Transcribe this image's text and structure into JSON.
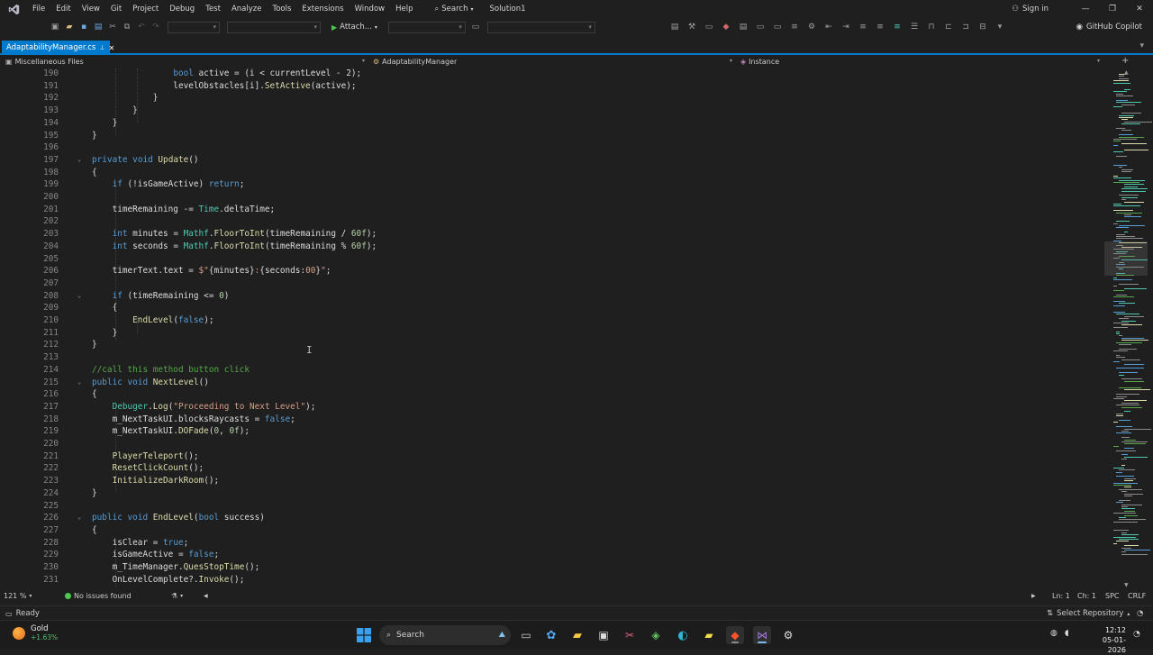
{
  "menubar": {
    "items": [
      "File",
      "Edit",
      "View",
      "Git",
      "Project",
      "Debug",
      "Test",
      "Analyze",
      "Tools",
      "Extensions",
      "Window",
      "Help"
    ],
    "search_label": "Search",
    "solution_name": "Solution1",
    "sign_in": "Sign in"
  },
  "toolbar": {
    "attach_label": "Attach...",
    "copilot_label": "GitHub Copilot"
  },
  "tab": {
    "filename": "AdaptabilityManager.cs",
    "pin_glyph": "⊥",
    "close_glyph": "✕"
  },
  "navbar": {
    "project": "Miscellaneous Files",
    "type": "AdaptabilityManager",
    "member": "Instance"
  },
  "editor": {
    "zoom": "121 %",
    "issues": "No issues found",
    "line": "Ln: 1",
    "col": "Ch: 1",
    "whitespace": "SPC",
    "eol": "CRLF"
  },
  "code_lines": [
    {
      "n": "190",
      "fold": "",
      "segs": [
        [
          "pl",
          "                "
        ],
        [
          "kw",
          "bool"
        ],
        [
          "pl",
          " active = (i < currentLevel - 2);"
        ]
      ]
    },
    {
      "n": "191",
      "fold": "",
      "segs": [
        [
          "pl",
          "                levelObstacles[i]."
        ],
        [
          "fn",
          "SetActive"
        ],
        [
          "pl",
          "(active);"
        ]
      ]
    },
    {
      "n": "192",
      "fold": "",
      "segs": [
        [
          "pl",
          "            }"
        ]
      ]
    },
    {
      "n": "193",
      "fold": "",
      "segs": [
        [
          "pl",
          "        }"
        ]
      ]
    },
    {
      "n": "194",
      "fold": "",
      "segs": [
        [
          "pl",
          "    }"
        ]
      ]
    },
    {
      "n": "195",
      "fold": "",
      "segs": [
        [
          "pl",
          "}"
        ]
      ]
    },
    {
      "n": "196",
      "fold": "",
      "segs": [
        [
          "pl",
          ""
        ]
      ]
    },
    {
      "n": "197",
      "fold": "v",
      "segs": [
        [
          "kw",
          "private"
        ],
        [
          "pl",
          " "
        ],
        [
          "kw",
          "void"
        ],
        [
          "pl",
          " "
        ],
        [
          "fn",
          "Update"
        ],
        [
          "pl",
          "()"
        ]
      ]
    },
    {
      "n": "198",
      "fold": "",
      "segs": [
        [
          "pl",
          "{"
        ]
      ]
    },
    {
      "n": "199",
      "fold": "",
      "segs": [
        [
          "pl",
          "    "
        ],
        [
          "kw",
          "if"
        ],
        [
          "pl",
          " (!isGameActive) "
        ],
        [
          "kw",
          "return"
        ],
        [
          "pl",
          ";"
        ]
      ]
    },
    {
      "n": "200",
      "fold": "",
      "segs": [
        [
          "pl",
          ""
        ]
      ]
    },
    {
      "n": "201",
      "fold": "",
      "segs": [
        [
          "pl",
          "    timeRemaining -= "
        ],
        [
          "ty",
          "Time"
        ],
        [
          "pl",
          ".deltaTime;"
        ]
      ]
    },
    {
      "n": "202",
      "fold": "",
      "segs": [
        [
          "pl",
          ""
        ]
      ]
    },
    {
      "n": "203",
      "fold": "",
      "segs": [
        [
          "pl",
          "    "
        ],
        [
          "kw",
          "int"
        ],
        [
          "pl",
          " minutes = "
        ],
        [
          "ty",
          "Mathf"
        ],
        [
          "pl",
          "."
        ],
        [
          "fn",
          "FloorToInt"
        ],
        [
          "pl",
          "(timeRemaining / "
        ],
        [
          "num",
          "60f"
        ],
        [
          "pl",
          ");"
        ]
      ]
    },
    {
      "n": "204",
      "fold": "",
      "segs": [
        [
          "pl",
          "    "
        ],
        [
          "kw",
          "int"
        ],
        [
          "pl",
          " seconds = "
        ],
        [
          "ty",
          "Mathf"
        ],
        [
          "pl",
          "."
        ],
        [
          "fn",
          "FloorToInt"
        ],
        [
          "pl",
          "(timeRemaining % "
        ],
        [
          "num",
          "60f"
        ],
        [
          "pl",
          ");"
        ]
      ]
    },
    {
      "n": "205",
      "fold": "",
      "segs": [
        [
          "pl",
          ""
        ]
      ]
    },
    {
      "n": "206",
      "fold": "",
      "segs": [
        [
          "pl",
          "    timerText.text = "
        ],
        [
          "str",
          "$\""
        ],
        [
          "pl",
          "{minutes}"
        ],
        [
          "str",
          ":"
        ],
        [
          "pl",
          "{seconds:"
        ],
        [
          "str",
          "00"
        ],
        [
          "pl",
          "}"
        ],
        [
          "str",
          "\""
        ],
        [
          "pl",
          ";"
        ]
      ]
    },
    {
      "n": "207",
      "fold": "",
      "segs": [
        [
          "pl",
          ""
        ]
      ]
    },
    {
      "n": "208",
      "fold": "v",
      "segs": [
        [
          "pl",
          "    "
        ],
        [
          "kw",
          "if"
        ],
        [
          "pl",
          " (timeRemaining <= "
        ],
        [
          "num",
          "0"
        ],
        [
          "pl",
          ")"
        ]
      ]
    },
    {
      "n": "209",
      "fold": "",
      "segs": [
        [
          "pl",
          "    {"
        ]
      ]
    },
    {
      "n": "210",
      "fold": "",
      "segs": [
        [
          "pl",
          "        "
        ],
        [
          "fn",
          "EndLevel"
        ],
        [
          "pl",
          "("
        ],
        [
          "kw",
          "false"
        ],
        [
          "pl",
          ");"
        ]
      ]
    },
    {
      "n": "211",
      "fold": "",
      "segs": [
        [
          "pl",
          "    }"
        ]
      ]
    },
    {
      "n": "212",
      "fold": "",
      "segs": [
        [
          "pl",
          "}"
        ]
      ]
    },
    {
      "n": "213",
      "fold": "",
      "segs": [
        [
          "pl",
          ""
        ]
      ]
    },
    {
      "n": "214",
      "fold": "",
      "segs": [
        [
          "cm",
          "//call this method button click"
        ]
      ]
    },
    {
      "n": "215",
      "fold": "v",
      "segs": [
        [
          "kw",
          "public"
        ],
        [
          "pl",
          " "
        ],
        [
          "kw",
          "void"
        ],
        [
          "pl",
          " "
        ],
        [
          "fn",
          "NextLevel"
        ],
        [
          "pl",
          "()"
        ]
      ]
    },
    {
      "n": "216",
      "fold": "",
      "segs": [
        [
          "pl",
          "{"
        ]
      ]
    },
    {
      "n": "217",
      "fold": "",
      "segs": [
        [
          "pl",
          "    "
        ],
        [
          "ty",
          "Debuger"
        ],
        [
          "pl",
          "."
        ],
        [
          "fn",
          "Log"
        ],
        [
          "pl",
          "("
        ],
        [
          "str",
          "\"Proceeding to Next Level\""
        ],
        [
          "pl",
          ");"
        ]
      ]
    },
    {
      "n": "218",
      "fold": "",
      "segs": [
        [
          "pl",
          "    m_NextTaskUI.blocksRaycasts = "
        ],
        [
          "kw",
          "false"
        ],
        [
          "pl",
          ";"
        ]
      ]
    },
    {
      "n": "219",
      "fold": "",
      "segs": [
        [
          "pl",
          "    m_NextTaskUI."
        ],
        [
          "fn",
          "DOFade"
        ],
        [
          "pl",
          "("
        ],
        [
          "num",
          "0"
        ],
        [
          "pl",
          ", "
        ],
        [
          "num",
          "0f"
        ],
        [
          "pl",
          ");"
        ]
      ]
    },
    {
      "n": "220",
      "fold": "",
      "segs": [
        [
          "pl",
          ""
        ]
      ]
    },
    {
      "n": "221",
      "fold": "",
      "segs": [
        [
          "pl",
          "    "
        ],
        [
          "fn",
          "PlayerTeleport"
        ],
        [
          "pl",
          "();"
        ]
      ]
    },
    {
      "n": "222",
      "fold": "",
      "segs": [
        [
          "pl",
          "    "
        ],
        [
          "fn",
          "ResetClickCount"
        ],
        [
          "pl",
          "();"
        ]
      ]
    },
    {
      "n": "223",
      "fold": "",
      "segs": [
        [
          "pl",
          "    "
        ],
        [
          "fn",
          "InitializeDarkRoom"
        ],
        [
          "pl",
          "();"
        ]
      ]
    },
    {
      "n": "224",
      "fold": "",
      "segs": [
        [
          "pl",
          "}"
        ]
      ]
    },
    {
      "n": "225",
      "fold": "",
      "segs": [
        [
          "pl",
          ""
        ]
      ]
    },
    {
      "n": "226",
      "fold": "v",
      "segs": [
        [
          "kw",
          "public"
        ],
        [
          "pl",
          " "
        ],
        [
          "kw",
          "void"
        ],
        [
          "pl",
          " "
        ],
        [
          "fn",
          "EndLevel"
        ],
        [
          "pl",
          "("
        ],
        [
          "kw",
          "bool"
        ],
        [
          "pl",
          " success)"
        ]
      ]
    },
    {
      "n": "227",
      "fold": "",
      "segs": [
        [
          "pl",
          "{"
        ]
      ]
    },
    {
      "n": "228",
      "fold": "",
      "segs": [
        [
          "pl",
          "    isClear = "
        ],
        [
          "kw",
          "true"
        ],
        [
          "pl",
          ";"
        ]
      ]
    },
    {
      "n": "229",
      "fold": "",
      "segs": [
        [
          "pl",
          "    isGameActive = "
        ],
        [
          "kw",
          "false"
        ],
        [
          "pl",
          ";"
        ]
      ]
    },
    {
      "n": "230",
      "fold": "",
      "segs": [
        [
          "pl",
          "    m_TimeManager."
        ],
        [
          "fn",
          "QuesStopTime"
        ],
        [
          "pl",
          "();"
        ]
      ]
    },
    {
      "n": "231",
      "fold": "",
      "segs": [
        [
          "pl",
          "    OnLevelComplete?."
        ],
        [
          "fn",
          "Invoke"
        ],
        [
          "pl",
          "();"
        ]
      ]
    }
  ],
  "statusbar": {
    "ready": "Ready",
    "repo": "Select Repository"
  },
  "taskbar": {
    "weather_name": "Gold",
    "weather_change": "+1.63%",
    "search": "Search",
    "time": "12:12",
    "date": "05-01-2026"
  },
  "colors": {
    "accent": "#007acc",
    "keyword": "#569cd6",
    "type": "#4ec9b0",
    "method": "#dcdcaa",
    "string": "#d69d85",
    "comment": "#57a64a"
  }
}
